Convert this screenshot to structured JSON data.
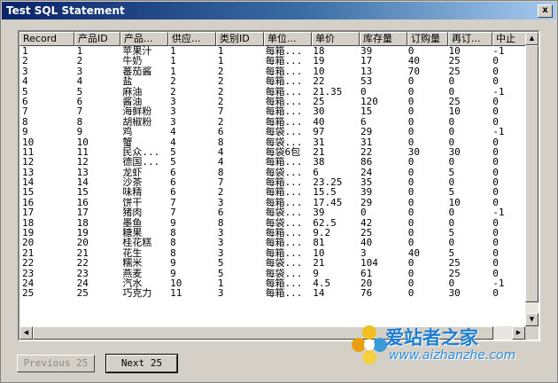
{
  "window": {
    "title": "Test SQL Statement",
    "close_label": "x"
  },
  "table": {
    "columns": [
      "Record",
      "产品ID",
      "产品...",
      "供应...",
      "类别ID",
      "单位...",
      "单价",
      "库存量",
      "订购量",
      "再订...",
      "中止"
    ],
    "rows": [
      [
        "1",
        "1",
        "苹果汁",
        "1",
        "1",
        "每箱...",
        "18",
        "39",
        "0",
        "10",
        "-1"
      ],
      [
        "2",
        "2",
        "牛奶",
        "1",
        "1",
        "每箱...",
        "19",
        "17",
        "40",
        "25",
        "0"
      ],
      [
        "3",
        "3",
        "蕃茄酱",
        "1",
        "2",
        "每箱...",
        "10",
        "13",
        "70",
        "25",
        "0"
      ],
      [
        "4",
        "4",
        "盐",
        "2",
        "2",
        "每箱...",
        "22",
        "53",
        "0",
        "0",
        "0"
      ],
      [
        "5",
        "5",
        "麻油",
        "2",
        "2",
        "每箱...",
        "21.35",
        "0",
        "0",
        "0",
        "-1"
      ],
      [
        "6",
        "6",
        "酱油",
        "3",
        "2",
        "每箱...",
        "25",
        "120",
        "0",
        "25",
        "0"
      ],
      [
        "7",
        "7",
        "海鲜粉",
        "3",
        "7",
        "每箱...",
        "30",
        "15",
        "0",
        "10",
        "0"
      ],
      [
        "8",
        "8",
        "胡椒粉",
        "3",
        "2",
        "每箱...",
        "40",
        "6",
        "0",
        "0",
        "0"
      ],
      [
        "9",
        "9",
        "鸡",
        "4",
        "6",
        "每袋...",
        "97",
        "29",
        "0",
        "0",
        "-1"
      ],
      [
        "10",
        "10",
        "蟹",
        "4",
        "8",
        "每袋...",
        "31",
        "31",
        "0",
        "0",
        "0"
      ],
      [
        "11",
        "11",
        "民众...",
        "5",
        "4",
        "每袋6包",
        "21",
        "22",
        "30",
        "30",
        "0"
      ],
      [
        "12",
        "12",
        "德国...",
        "5",
        "4",
        "每箱...",
        "38",
        "86",
        "0",
        "0",
        "0"
      ],
      [
        "13",
        "13",
        "龙虾",
        "6",
        "8",
        "每袋...",
        "6",
        "24",
        "0",
        "5",
        "0"
      ],
      [
        "14",
        "14",
        "沙茶",
        "6",
        "7",
        "每箱...",
        "23.25",
        "35",
        "0",
        "0",
        "0"
      ],
      [
        "15",
        "15",
        "味精",
        "6",
        "2",
        "每箱...",
        "15.5",
        "39",
        "0",
        "5",
        "0"
      ],
      [
        "16",
        "16",
        "饼干",
        "7",
        "3",
        "每箱...",
        "17.45",
        "29",
        "0",
        "10",
        "0"
      ],
      [
        "17",
        "17",
        "猪肉",
        "7",
        "6",
        "每袋...",
        "39",
        "0",
        "0",
        "0",
        "-1"
      ],
      [
        "18",
        "18",
        "墨鱼",
        "9",
        "8",
        "每袋...",
        "62.5",
        "42",
        "0",
        "0",
        "0"
      ],
      [
        "19",
        "19",
        "糖果",
        "8",
        "3",
        "每箱...",
        "9.2",
        "25",
        "0",
        "5",
        "0"
      ],
      [
        "20",
        "20",
        "桂花糕",
        "8",
        "3",
        "每箱...",
        "81",
        "40",
        "0",
        "0",
        "0"
      ],
      [
        "21",
        "21",
        "花生",
        "8",
        "3",
        "每箱...",
        "10",
        "3",
        "40",
        "5",
        "0"
      ],
      [
        "22",
        "22",
        "糯米",
        "9",
        "5",
        "每袋...",
        "21",
        "104",
        "0",
        "25",
        "0"
      ],
      [
        "23",
        "23",
        "燕麦",
        "9",
        "5",
        "每袋...",
        "9",
        "61",
        "0",
        "25",
        "0"
      ],
      [
        "24",
        "24",
        "汽水",
        "10",
        "1",
        "每箱...",
        "4.5",
        "20",
        "0",
        "0",
        "-1"
      ],
      [
        "25",
        "25",
        "巧克力",
        "11",
        "3",
        "每箱...",
        "14",
        "76",
        "0",
        "30",
        "0"
      ]
    ]
  },
  "buttons": {
    "previous_label": "Previous 25",
    "next_label": "Next 25"
  },
  "watermark": {
    "brand": "爱站者之家",
    "url": "www.aizhanzhe.com"
  }
}
